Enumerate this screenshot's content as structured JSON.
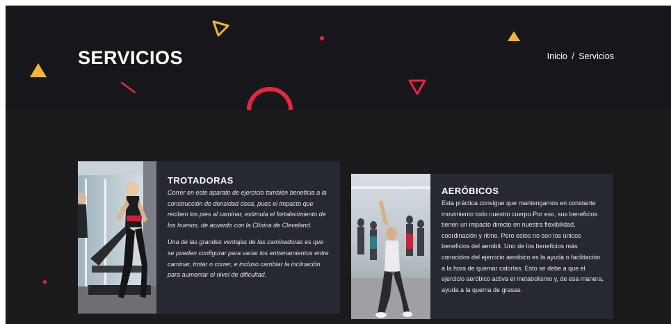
{
  "hero": {
    "title": "SERVICIOS",
    "breadcrumb": {
      "home": "Inicio",
      "separator": "/",
      "current": "Servicios"
    }
  },
  "colors": {
    "hero_bg": "#17171b",
    "page_bg": "#1b1b1d",
    "card_bg": "#262932",
    "accent_yellow": "#f2b632",
    "accent_red": "#e8263e"
  },
  "decorations": [
    "triangle-yellow",
    "triangle-outline-yellow",
    "triangle-outline-red",
    "half-ring-red",
    "slash-red",
    "dot-red"
  ],
  "services": [
    {
      "title": "TROTADORAS",
      "image": "woman-on-treadmill-photo",
      "paragraphs": [
        "Correr en este aparato de ejercicio también beneficia a la construcción de densidad ósea, pues el impacto que reciben los pies al caminar, estimula el fortalecimiento de los huesos, de acuerdo con la Clínica de Cleveland.",
        "Una de las grandes ventajas de las caminadoras es que se pueden configurar para variar los entrenamientos entre caminar, trotar o correr, e incluso cambiar la inclinación para aumentar el nivel de dificultad."
      ]
    },
    {
      "title": "AERÓBICOS",
      "image": "aerobics-class-photo",
      "paragraphs": [
        "Esta práctica consigue que mantengamos en constante movimiento todo nuestro cuerpo.Por eso, sus beneficios tienen un impacto directo en nuestra flexibilidad, coordinación y ritmo. Pero estos no son los únicos beneficios del aerobit. Uno de los beneficios más conocidos del ejercicio aeróbico es la ayuda o facilitación a la hora de quemar calorías. Esto se debe a que el ejercicio aeróbico activa el metabolismo y, de esa manera, ayuda a la quema de grasas."
      ]
    }
  ]
}
